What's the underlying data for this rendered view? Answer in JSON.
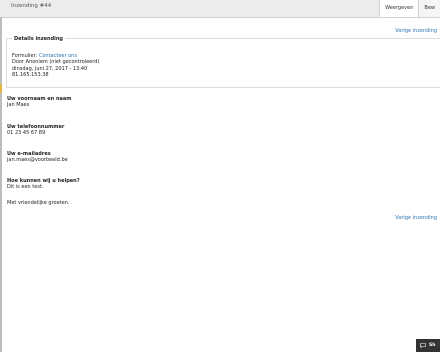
{
  "header": {
    "title": "Inzending #44",
    "tabs": [
      "Weergeven",
      "Bew"
    ]
  },
  "pager": {
    "top_label": "Vorige inzending",
    "bottom_label": "Vorige inzending"
  },
  "details": {
    "legend": "Details inzending",
    "form_prefix": "Formulier: ",
    "form_link": "Contacteer ons",
    "author": "Door Anoniem (niet gecontroleerd)",
    "date": "dinsdag, juni 27, 2017 - 13:40",
    "ip": "81.165.153.38"
  },
  "fields": [
    {
      "label": "Uw voornaam en naam",
      "value": "Jan Maes"
    },
    {
      "label": "Uw telefoonnummer",
      "value": "01 23 45 67 89"
    },
    {
      "label": "Uw e-mailadres",
      "value": "jan.maes@voorbeeld.be"
    },
    {
      "label": "Hoe kunnen wij u helpen?",
      "value": "Dit is een test."
    }
  ],
  "closing": "Met vriendelijke groeten.",
  "feedback": {
    "icon": "chat-bubble-icon",
    "label": "Sh"
  }
}
